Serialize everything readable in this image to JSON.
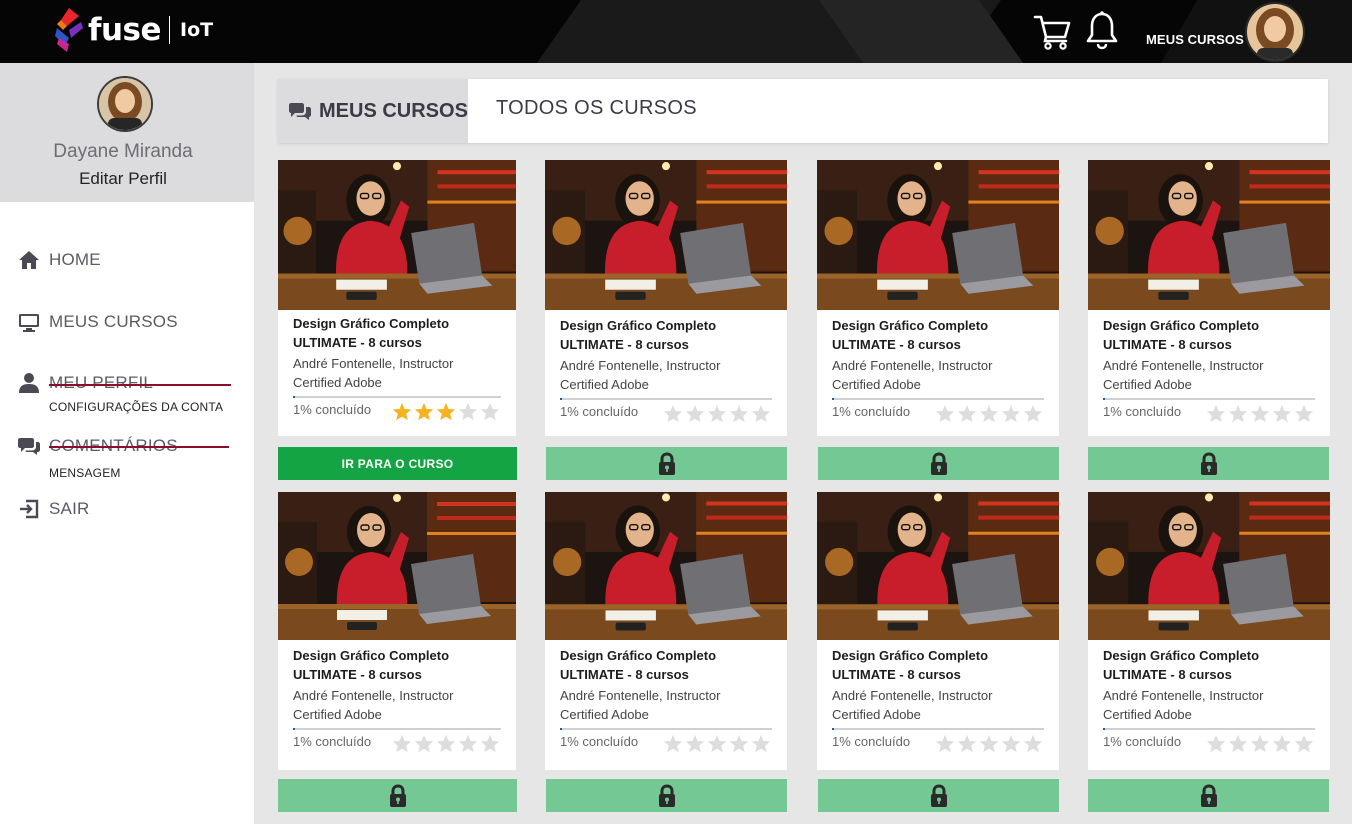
{
  "header": {
    "logo_text": "fuse",
    "logo_sub": "IoT",
    "my_courses_label": "MEUS CURSOS",
    "icons": [
      "cart-icon",
      "bell-icon"
    ]
  },
  "sidebar": {
    "user_name": "Dayane Miranda",
    "edit_profile": "Editar Perfil",
    "items": [
      {
        "label": "HOME",
        "icon": "home-icon"
      },
      {
        "label": "MEUS CURSOS",
        "icon": "monitor-icon"
      },
      {
        "label": "MEU PERFIL",
        "icon": "user-icon",
        "sub": "CONFIGURAÇÕES DA CONTA"
      },
      {
        "label": "COMENTÁRIOS",
        "icon": "chat-icon",
        "sub": "MENSAGEM"
      },
      {
        "label": "SAIR",
        "icon": "logout-icon"
      }
    ]
  },
  "tabs": {
    "active": "MEUS CURSOS",
    "other": "TODOS OS CURSOS"
  },
  "courses": [
    {
      "title1": "Design Gráfico Completo",
      "title2": "ULTIMATE - 8 cursos",
      "instructor1": "André Fontenelle, Instructor",
      "instructor2": "Certified Adobe",
      "progress_label": "1% concluído",
      "progress": 0.01,
      "rating": 3,
      "cta": "IR PARA O CURSO",
      "locked": false
    },
    {
      "title1": "Design Gráfico Completo",
      "title2": "ULTIMATE - 8 cursos",
      "instructor1": "André Fontenelle, Instructor",
      "instructor2": "Certified Adobe",
      "progress_label": "1% concluído",
      "progress": 0.01,
      "rating": 0,
      "cta": "",
      "locked": true
    },
    {
      "title1": "Design Gráfico Completo",
      "title2": "ULTIMATE - 8 cursos",
      "instructor1": "André Fontenelle, Instructor",
      "instructor2": "Certified Adobe",
      "progress_label": "1% concluído",
      "progress": 0.01,
      "rating": 0,
      "cta": "",
      "locked": true
    },
    {
      "title1": "Design Gráfico Completo",
      "title2": "ULTIMATE - 8 cursos",
      "instructor1": "André Fontenelle, Instructor",
      "instructor2": "Certified Adobe",
      "progress_label": "1% concluído",
      "progress": 0.01,
      "rating": 0,
      "cta": "",
      "locked": true
    },
    {
      "title1": "Design Gráfico Completo",
      "title2": "ULTIMATE - 8 cursos",
      "instructor1": "André Fontenelle, Instructor",
      "instructor2": "Certified Adobe",
      "progress_label": "1% concluído",
      "progress": 0.01,
      "rating": 0,
      "cta": "",
      "locked": true
    },
    {
      "title1": "Design Gráfico Completo",
      "title2": "ULTIMATE - 8 cursos",
      "instructor1": "André Fontenelle, Instructor",
      "instructor2": "Certified Adobe",
      "progress_label": "1% concluído",
      "progress": 0.01,
      "rating": 0,
      "cta": "",
      "locked": true
    },
    {
      "title1": "Design Gráfico Completo",
      "title2": "ULTIMATE - 8 cursos",
      "instructor1": "André Fontenelle, Instructor",
      "instructor2": "Certified Adobe",
      "progress_label": "1% concluído",
      "progress": 0.01,
      "rating": 0,
      "cta": "",
      "locked": true
    },
    {
      "title1": "Design Gráfico Completo",
      "title2": "ULTIMATE - 8 cursos",
      "instructor1": "André Fontenelle, Instructor",
      "instructor2": "Certified Adobe",
      "progress_label": "1% concluído",
      "progress": 0.01,
      "rating": 0,
      "cta": "",
      "locked": true
    }
  ],
  "colors": {
    "go_button": "#15a443",
    "locked_button": "#74c894",
    "star_filled": "#f5b41f",
    "star_empty": "#dddddd",
    "strike": "#8a0f2e"
  }
}
